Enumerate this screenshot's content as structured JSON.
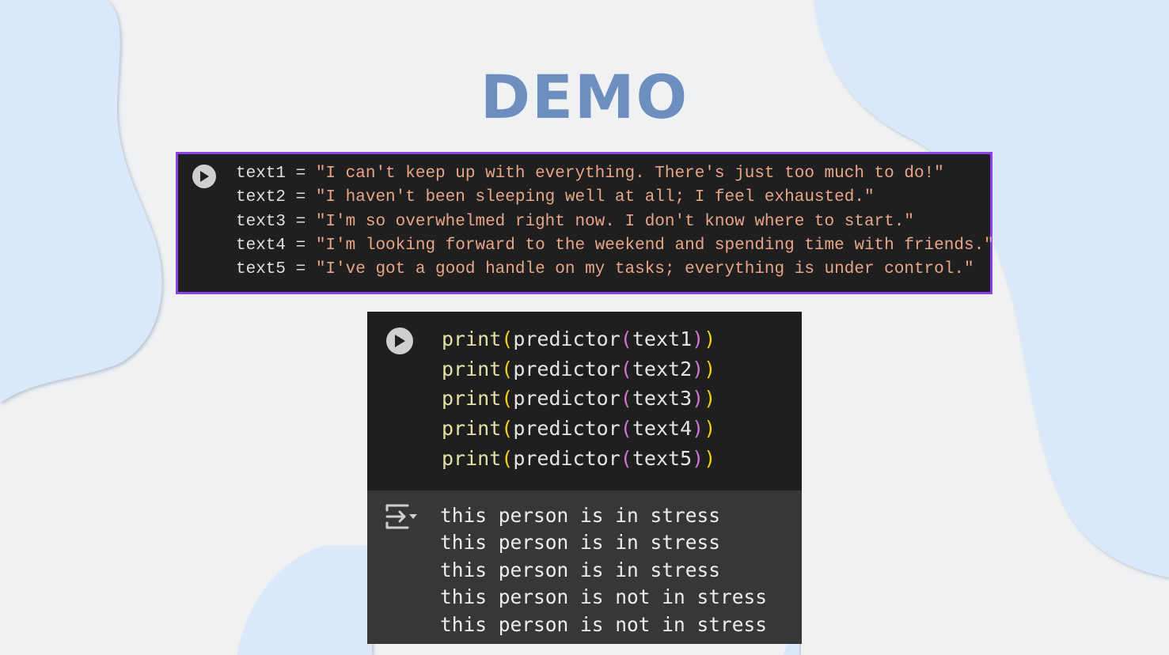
{
  "slide": {
    "title": "DEMO"
  },
  "input_cell": {
    "run_icon": "play-circle-icon",
    "lines": [
      {
        "var": "text1",
        "op": " = ",
        "value": "\"I can't keep up with everything. There's just too much to do!\""
      },
      {
        "var": "text2",
        "op": " = ",
        "value": "\"I haven't been sleeping well at all; I feel exhausted.\""
      },
      {
        "var": "text3",
        "op": " = ",
        "value": "\"I'm so overwhelmed right now. I don't know where to start.\""
      },
      {
        "var": "text4",
        "op": " = ",
        "value": "\"I'm looking forward to the weekend and spending time with friends.\""
      },
      {
        "var": "text5",
        "op": " = ",
        "value": "\"I've got a good handle on my tasks; everything is under control.\""
      }
    ]
  },
  "predict_cell": {
    "run_icon": "play-circle-icon",
    "lines": [
      {
        "fn": "print",
        "inner": "predictor",
        "arg": "text1"
      },
      {
        "fn": "print",
        "inner": "predictor",
        "arg": "text2"
      },
      {
        "fn": "print",
        "inner": "predictor",
        "arg": "text3"
      },
      {
        "fn": "print",
        "inner": "predictor",
        "arg": "text4"
      },
      {
        "fn": "print",
        "inner": "predictor",
        "arg": "text5"
      }
    ],
    "output_icon": "output-toggle-icon",
    "output_lines": [
      "this person is in stress",
      "this person is in stress",
      "this person is in stress",
      "this person is not in stress",
      "this person is not in stress"
    ]
  },
  "colors": {
    "title": "#6c8fbf",
    "cell_border": "#8a42e6",
    "cell_background": "#1f1f1f",
    "output_background": "#373737",
    "string": "#e8a587",
    "function": "#e5e2a6",
    "paren_outer": "#f4d116",
    "paren_inner": "#d375d6",
    "blob": "#d9e8fa"
  }
}
